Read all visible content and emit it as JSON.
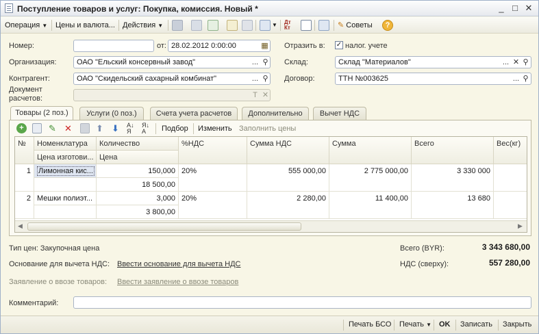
{
  "window": {
    "title": "Поступление товаров и услуг: Покупка, комиссия. Новый *",
    "minimize": "_",
    "maximize": "□",
    "close": "✕"
  },
  "toolbar": {
    "operation": "Операция",
    "prices_currency": "Цены и валюта...",
    "actions": "Действия",
    "dtkt": "Дт Кт",
    "tips": "Советы",
    "help": "?"
  },
  "header": {
    "number_label": "Номер:",
    "number_value": "",
    "date_label": "от:",
    "date_value": "28.02.2012  0:00:00",
    "reflect_label": "Отразить в:",
    "tax_checkbox_label": "налог. учете",
    "tax_checked": "✓",
    "org_label": "Организация:",
    "org_value": "ОАО \"Ельский консервный завод\"",
    "warehouse_label": "Склад:",
    "warehouse_value": "Склад \"Материалов\"",
    "contractor_label": "Контрагент:",
    "contractor_value": "ОАО \"Скидельский сахарный комбинат\"",
    "contract_label": "Договор:",
    "contract_value": "ТТН №003625",
    "settlement_doc_label_1": "Документ",
    "settlement_doc_label_2": "расчетов:",
    "settlement_doc_value": ""
  },
  "tabs": [
    {
      "label": "Товары (2 поз.)"
    },
    {
      "label": "Услуги (0 поз.)"
    },
    {
      "label": "Счета учета расчетов"
    },
    {
      "label": "Дополнительно"
    },
    {
      "label": "Вычет НДС"
    }
  ],
  "table_toolbar": {
    "pick": "Подбор",
    "change": "Изменить",
    "fill_prices": "Заполнить цены"
  },
  "table": {
    "headers": {
      "num": "№",
      "nomenclature": "Номенклатура",
      "manufacturer_price": "Цена изготови...",
      "quantity": "Количество",
      "price": "Цена",
      "vat_rate": "%НДС",
      "vat_sum": "Сумма НДС",
      "sum": "Сумма",
      "total": "Всего",
      "weight": "Вес(кг)"
    },
    "rows": [
      {
        "num": "1",
        "nomenclature": "Лимонная кис...",
        "quantity": "150,000",
        "price": "18 500,00",
        "vat_rate": "20%",
        "vat_sum": "555 000,00",
        "sum": "2 775 000,00",
        "total": "3 330 000"
      },
      {
        "num": "2",
        "nomenclature": "Мешки полиэт...",
        "quantity": "3,000",
        "price": "3 800,00",
        "vat_rate": "20%",
        "vat_sum": "2 280,00",
        "sum": "11 400,00",
        "total": "13 680"
      }
    ]
  },
  "summary": {
    "price_type": "Тип цен: Закупочная цена",
    "total_label": "Всего (BYR):",
    "total_value": "3 343 680,00",
    "vat_label": "НДС (сверху):",
    "vat_value": "557 280,00",
    "vat_basis_label": "Основание для вычета НДС:",
    "vat_basis_link": "Ввести основание для вычета НДС",
    "import_label": "Заявление о ввозе товаров:",
    "import_link": "Ввести заявление о ввозе товаров",
    "comment_label": "Комментарий:",
    "comment_value": ""
  },
  "footer": {
    "print_bso": "Печать БСО",
    "print": "Печать",
    "ok": "OK",
    "save": "Записать",
    "close": "Закрыть"
  }
}
